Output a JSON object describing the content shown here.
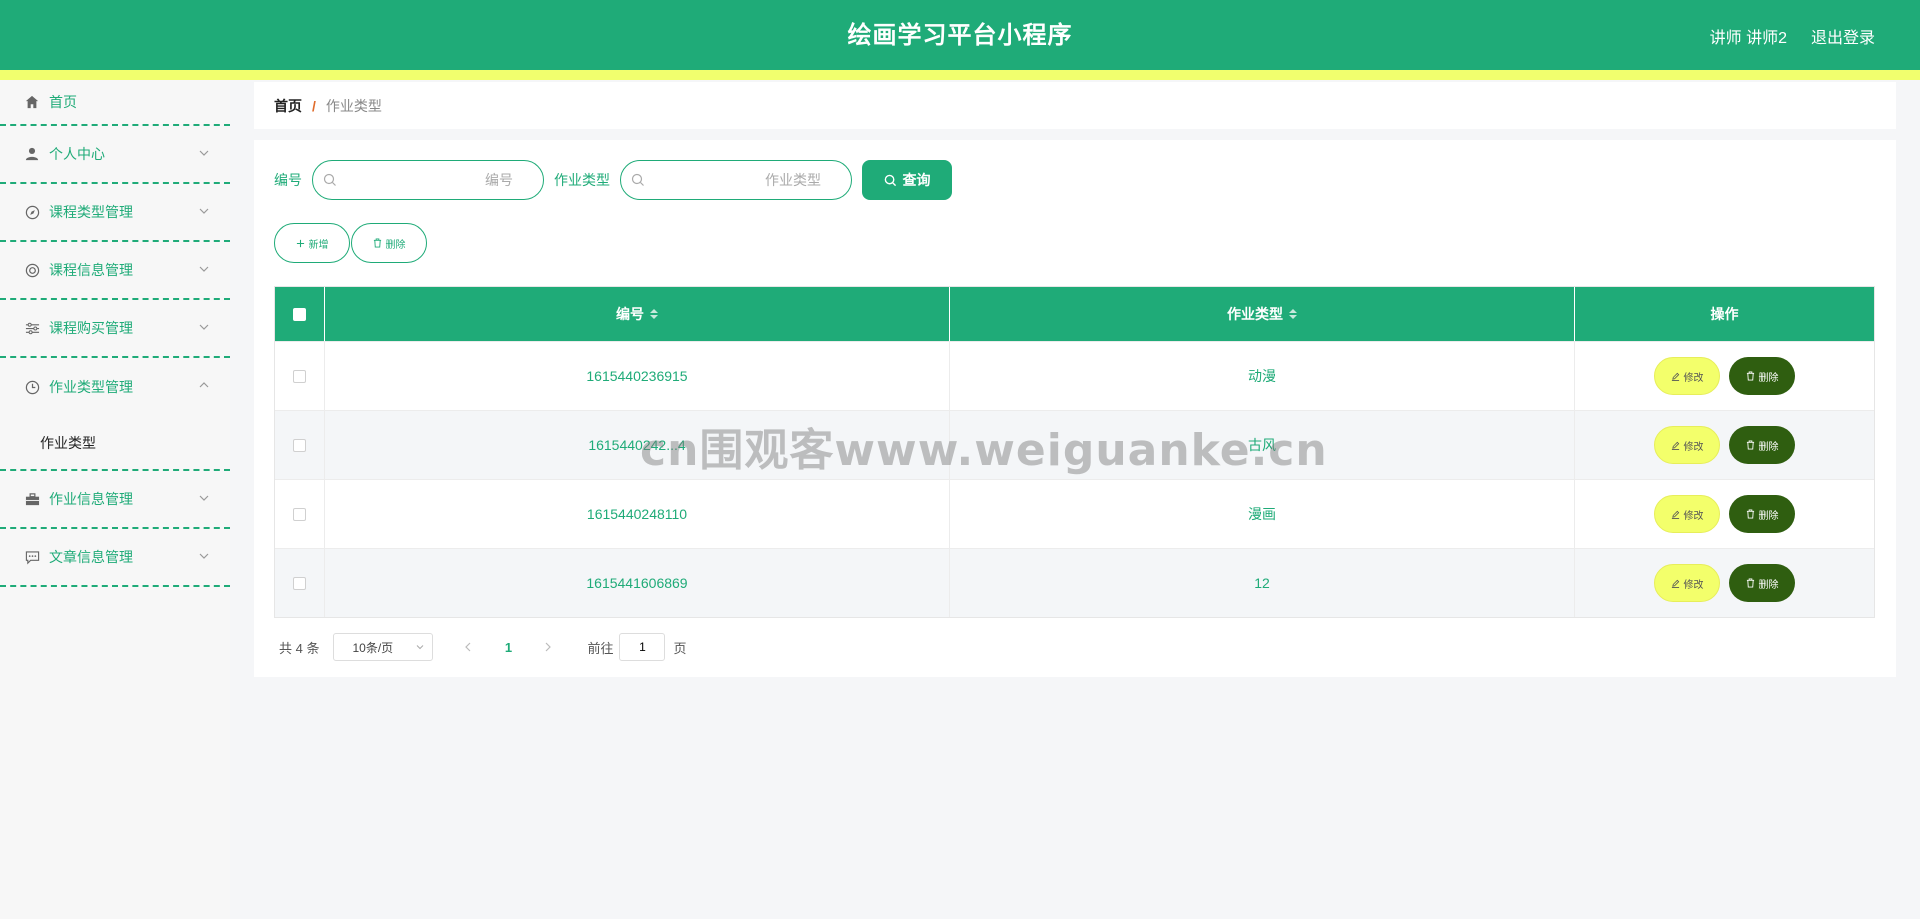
{
  "header": {
    "title": "绘画学习平台小程序",
    "user_label": "讲师 讲师2",
    "logout_label": "退出登录",
    "bg_color": "#1fab78",
    "stripe_color": "#f1ff6e"
  },
  "sidebar": {
    "items": [
      {
        "label": "首页",
        "icon": "home-icon"
      },
      {
        "label": "个人中心",
        "icon": "user-icon"
      },
      {
        "label": "课程类型管理",
        "icon": "compass-icon"
      },
      {
        "label": "课程信息管理",
        "icon": "lifebuoy-icon"
      },
      {
        "label": "课程购买管理",
        "icon": "sliders-icon"
      },
      {
        "label": "作业类型管理",
        "icon": "clock-icon",
        "expanded": true
      },
      {
        "label": "作业信息管理",
        "icon": "briefcase-icon"
      },
      {
        "label": "文章信息管理",
        "icon": "chat-icon"
      }
    ],
    "submenu": {
      "label": "作业类型"
    }
  },
  "breadcrumb": {
    "home": "首页",
    "separator": "/",
    "current": "作业类型"
  },
  "search": {
    "id_label": "编号",
    "id_placeholder": "编号",
    "type_label": "作业类型",
    "type_placeholder": "作业类型",
    "query_label": "查询"
  },
  "actions": {
    "add_label": "新增",
    "delete_label": "删除"
  },
  "table": {
    "headers": {
      "id": "编号",
      "type": "作业类型",
      "op": "操作"
    },
    "rows": [
      {
        "id": "1615440236915",
        "type": "动漫"
      },
      {
        "id": "1615440242...4",
        "type": "古风"
      },
      {
        "id": "1615440248110",
        "type": "漫画"
      },
      {
        "id": "1615441606869",
        "type": "12"
      }
    ],
    "edit_label": "修改",
    "delete_label": "删除"
  },
  "pagination": {
    "total_text": "共 4 条",
    "page_size": "10条/页",
    "current_page": "1",
    "goto_prefix": "前往",
    "goto_value": "1",
    "goto_suffix": "页"
  },
  "watermark": "cn围观客www.weiguanke.cn"
}
